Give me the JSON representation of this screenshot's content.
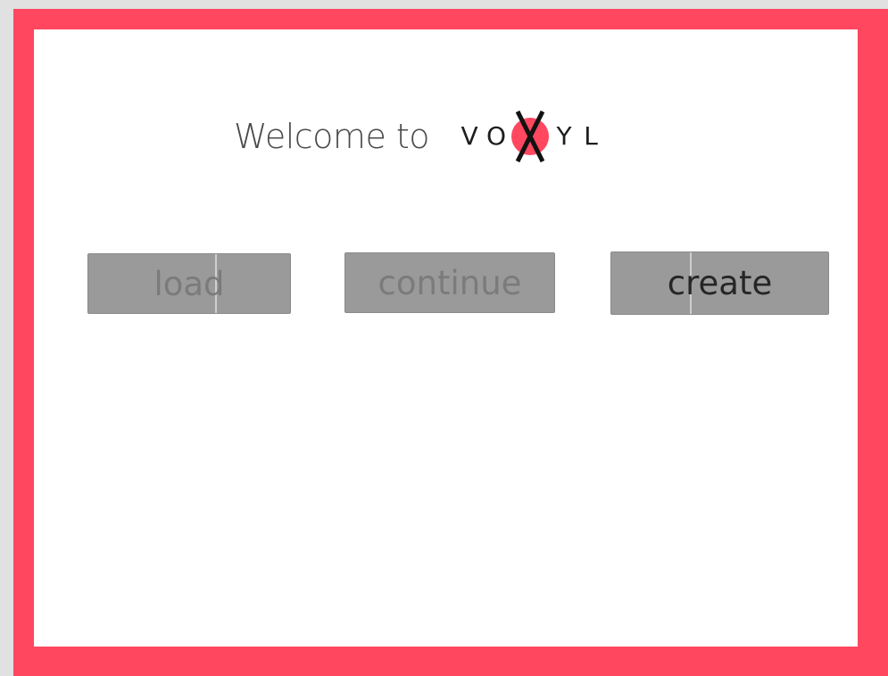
{
  "header": {
    "welcome_text": "Welcome to",
    "logo": {
      "letters_before": [
        "V",
        "O"
      ],
      "center_letter": "X",
      "letters_after": [
        "Y",
        "L"
      ],
      "center_dot_color": "#ff4760"
    }
  },
  "buttons": {
    "load_label": "load",
    "continue_label": "continue",
    "create_label": "create"
  },
  "colors": {
    "frame": "#ff4760",
    "panel": "#ffffff",
    "button_bg": "#9a9a9a",
    "disabled_text": "#7b7b7b",
    "enabled_text": "#262626"
  }
}
